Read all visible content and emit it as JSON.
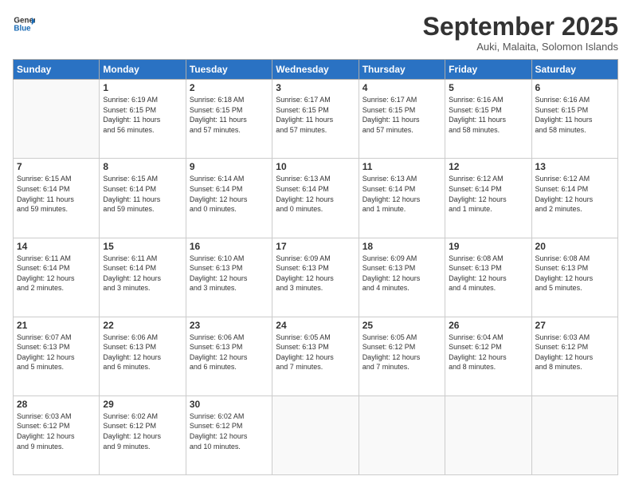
{
  "logo": {
    "line1": "General",
    "line2": "Blue"
  },
  "header": {
    "month": "September 2025",
    "location": "Auki, Malaita, Solomon Islands"
  },
  "days": [
    "Sunday",
    "Monday",
    "Tuesday",
    "Wednesday",
    "Thursday",
    "Friday",
    "Saturday"
  ],
  "weeks": [
    [
      {
        "num": "",
        "text": ""
      },
      {
        "num": "1",
        "text": "Sunrise: 6:19 AM\nSunset: 6:15 PM\nDaylight: 11 hours\nand 56 minutes."
      },
      {
        "num": "2",
        "text": "Sunrise: 6:18 AM\nSunset: 6:15 PM\nDaylight: 11 hours\nand 57 minutes."
      },
      {
        "num": "3",
        "text": "Sunrise: 6:17 AM\nSunset: 6:15 PM\nDaylight: 11 hours\nand 57 minutes."
      },
      {
        "num": "4",
        "text": "Sunrise: 6:17 AM\nSunset: 6:15 PM\nDaylight: 11 hours\nand 57 minutes."
      },
      {
        "num": "5",
        "text": "Sunrise: 6:16 AM\nSunset: 6:15 PM\nDaylight: 11 hours\nand 58 minutes."
      },
      {
        "num": "6",
        "text": "Sunrise: 6:16 AM\nSunset: 6:15 PM\nDaylight: 11 hours\nand 58 minutes."
      }
    ],
    [
      {
        "num": "7",
        "text": "Sunrise: 6:15 AM\nSunset: 6:14 PM\nDaylight: 11 hours\nand 59 minutes."
      },
      {
        "num": "8",
        "text": "Sunrise: 6:15 AM\nSunset: 6:14 PM\nDaylight: 11 hours\nand 59 minutes."
      },
      {
        "num": "9",
        "text": "Sunrise: 6:14 AM\nSunset: 6:14 PM\nDaylight: 12 hours\nand 0 minutes."
      },
      {
        "num": "10",
        "text": "Sunrise: 6:13 AM\nSunset: 6:14 PM\nDaylight: 12 hours\nand 0 minutes."
      },
      {
        "num": "11",
        "text": "Sunrise: 6:13 AM\nSunset: 6:14 PM\nDaylight: 12 hours\nand 1 minute."
      },
      {
        "num": "12",
        "text": "Sunrise: 6:12 AM\nSunset: 6:14 PM\nDaylight: 12 hours\nand 1 minute."
      },
      {
        "num": "13",
        "text": "Sunrise: 6:12 AM\nSunset: 6:14 PM\nDaylight: 12 hours\nand 2 minutes."
      }
    ],
    [
      {
        "num": "14",
        "text": "Sunrise: 6:11 AM\nSunset: 6:14 PM\nDaylight: 12 hours\nand 2 minutes."
      },
      {
        "num": "15",
        "text": "Sunrise: 6:11 AM\nSunset: 6:14 PM\nDaylight: 12 hours\nand 3 minutes."
      },
      {
        "num": "16",
        "text": "Sunrise: 6:10 AM\nSunset: 6:13 PM\nDaylight: 12 hours\nand 3 minutes."
      },
      {
        "num": "17",
        "text": "Sunrise: 6:09 AM\nSunset: 6:13 PM\nDaylight: 12 hours\nand 3 minutes."
      },
      {
        "num": "18",
        "text": "Sunrise: 6:09 AM\nSunset: 6:13 PM\nDaylight: 12 hours\nand 4 minutes."
      },
      {
        "num": "19",
        "text": "Sunrise: 6:08 AM\nSunset: 6:13 PM\nDaylight: 12 hours\nand 4 minutes."
      },
      {
        "num": "20",
        "text": "Sunrise: 6:08 AM\nSunset: 6:13 PM\nDaylight: 12 hours\nand 5 minutes."
      }
    ],
    [
      {
        "num": "21",
        "text": "Sunrise: 6:07 AM\nSunset: 6:13 PM\nDaylight: 12 hours\nand 5 minutes."
      },
      {
        "num": "22",
        "text": "Sunrise: 6:06 AM\nSunset: 6:13 PM\nDaylight: 12 hours\nand 6 minutes."
      },
      {
        "num": "23",
        "text": "Sunrise: 6:06 AM\nSunset: 6:13 PM\nDaylight: 12 hours\nand 6 minutes."
      },
      {
        "num": "24",
        "text": "Sunrise: 6:05 AM\nSunset: 6:13 PM\nDaylight: 12 hours\nand 7 minutes."
      },
      {
        "num": "25",
        "text": "Sunrise: 6:05 AM\nSunset: 6:12 PM\nDaylight: 12 hours\nand 7 minutes."
      },
      {
        "num": "26",
        "text": "Sunrise: 6:04 AM\nSunset: 6:12 PM\nDaylight: 12 hours\nand 8 minutes."
      },
      {
        "num": "27",
        "text": "Sunrise: 6:03 AM\nSunset: 6:12 PM\nDaylight: 12 hours\nand 8 minutes."
      }
    ],
    [
      {
        "num": "28",
        "text": "Sunrise: 6:03 AM\nSunset: 6:12 PM\nDaylight: 12 hours\nand 9 minutes."
      },
      {
        "num": "29",
        "text": "Sunrise: 6:02 AM\nSunset: 6:12 PM\nDaylight: 12 hours\nand 9 minutes."
      },
      {
        "num": "30",
        "text": "Sunrise: 6:02 AM\nSunset: 6:12 PM\nDaylight: 12 hours\nand 10 minutes."
      },
      {
        "num": "",
        "text": ""
      },
      {
        "num": "",
        "text": ""
      },
      {
        "num": "",
        "text": ""
      },
      {
        "num": "",
        "text": ""
      }
    ]
  ]
}
